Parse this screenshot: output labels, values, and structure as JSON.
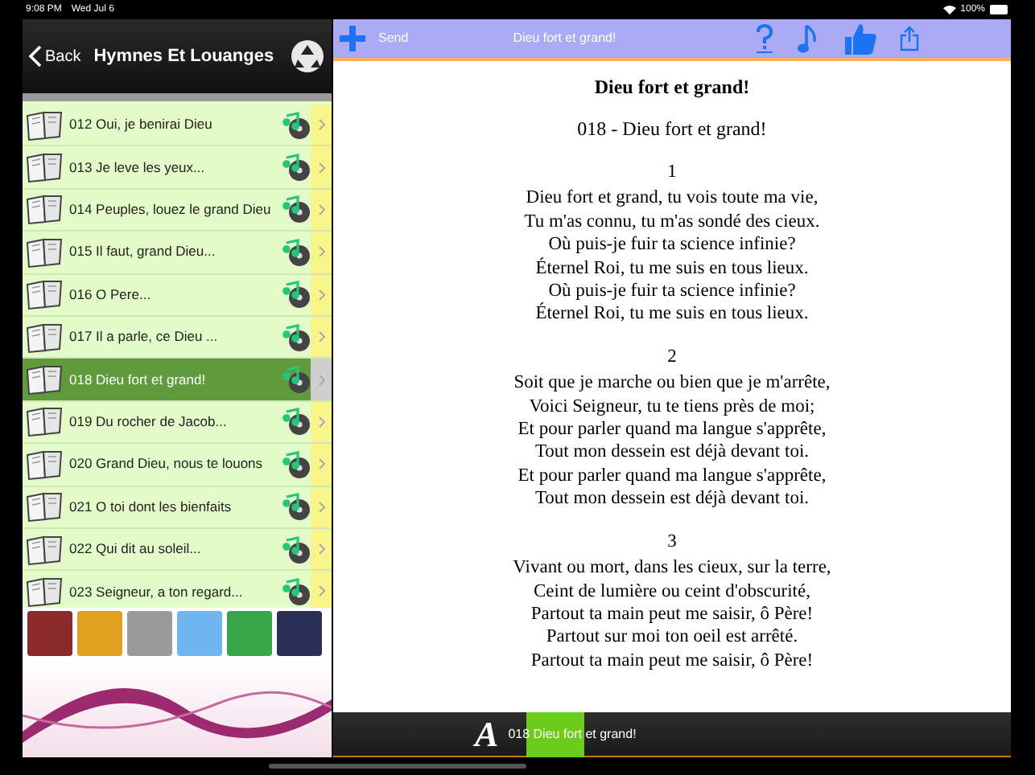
{
  "status_bar": {
    "time": "9:08 PM",
    "date": "Wed Jul 6",
    "battery": "100%"
  },
  "sidebar": {
    "back": "Back",
    "title": "Hymnes Et Louanges",
    "items": [
      {
        "title": "012 Oui, je benirai Dieu",
        "selected": false
      },
      {
        "title": "013 Je leve les yeux...",
        "selected": false
      },
      {
        "title": "014 Peuples, louez le grand Dieu",
        "selected": false
      },
      {
        "title": "015 Il faut, grand Dieu...",
        "selected": false
      },
      {
        "title": "016 O Pere...",
        "selected": false
      },
      {
        "title": "017 Il a parle, ce Dieu ...",
        "selected": false
      },
      {
        "title": "018 Dieu fort et grand!",
        "selected": true
      },
      {
        "title": "019 Du rocher de Jacob...",
        "selected": false
      },
      {
        "title": "020 Grand Dieu, nous te louons",
        "selected": false
      },
      {
        "title": "021 O toi dont les bienfaits",
        "selected": false
      },
      {
        "title": "022 Qui dit au soleil...",
        "selected": false
      },
      {
        "title": "023 Seigneur, a ton regard...",
        "selected": false
      }
    ],
    "apps": [
      {
        "color": "#8b2a2a"
      },
      {
        "color": "#e0a020"
      },
      {
        "color": "#9a9a9a"
      },
      {
        "color": "#6fb6f0"
      },
      {
        "color": "#3aa64a"
      },
      {
        "color": "#2a2f55"
      }
    ]
  },
  "toolbar": {
    "send": "Send",
    "title": "Dieu fort et grand!"
  },
  "hymn": {
    "heading": "Dieu fort et grand!",
    "subtitle": "018 - Dieu fort et grand!",
    "stanzas": [
      {
        "number": "1",
        "lines": [
          "Dieu fort et grand, tu vois toute ma vie,",
          "Tu m'as connu, tu m'as sondé des cieux.",
          "Où puis-je fuir ta science infinie?",
          "Éternel Roi, tu me suis en tous lieux.",
          "Où puis-je fuir ta science infinie?",
          "Éternel Roi, tu me suis en tous lieux."
        ]
      },
      {
        "number": "2",
        "lines": [
          "Soit que je marche ou bien que je m'arrête,",
          "Voici Seigneur, tu te tiens près de moi;",
          "Et pour parler quand ma langue s'apprête,",
          "Tout mon dessein est déjà devant toi.",
          "Et pour parler quand ma langue s'apprête,",
          "Tout mon dessein est déjà devant toi."
        ]
      },
      {
        "number": "3",
        "lines": [
          "Vivant ou mort, dans les cieux, sur la terre,",
          "Ceint de lumière ou ceint d'obscurité,",
          "Partout ta main peut me saisir, ô Père!",
          "Partout sur moi ton oeil est arrêté.",
          "Partout ta main peut me saisir, ô Père!"
        ]
      }
    ]
  },
  "bottom_bar": {
    "font_icon": "A",
    "track": "018 Dieu fort et grand!"
  }
}
